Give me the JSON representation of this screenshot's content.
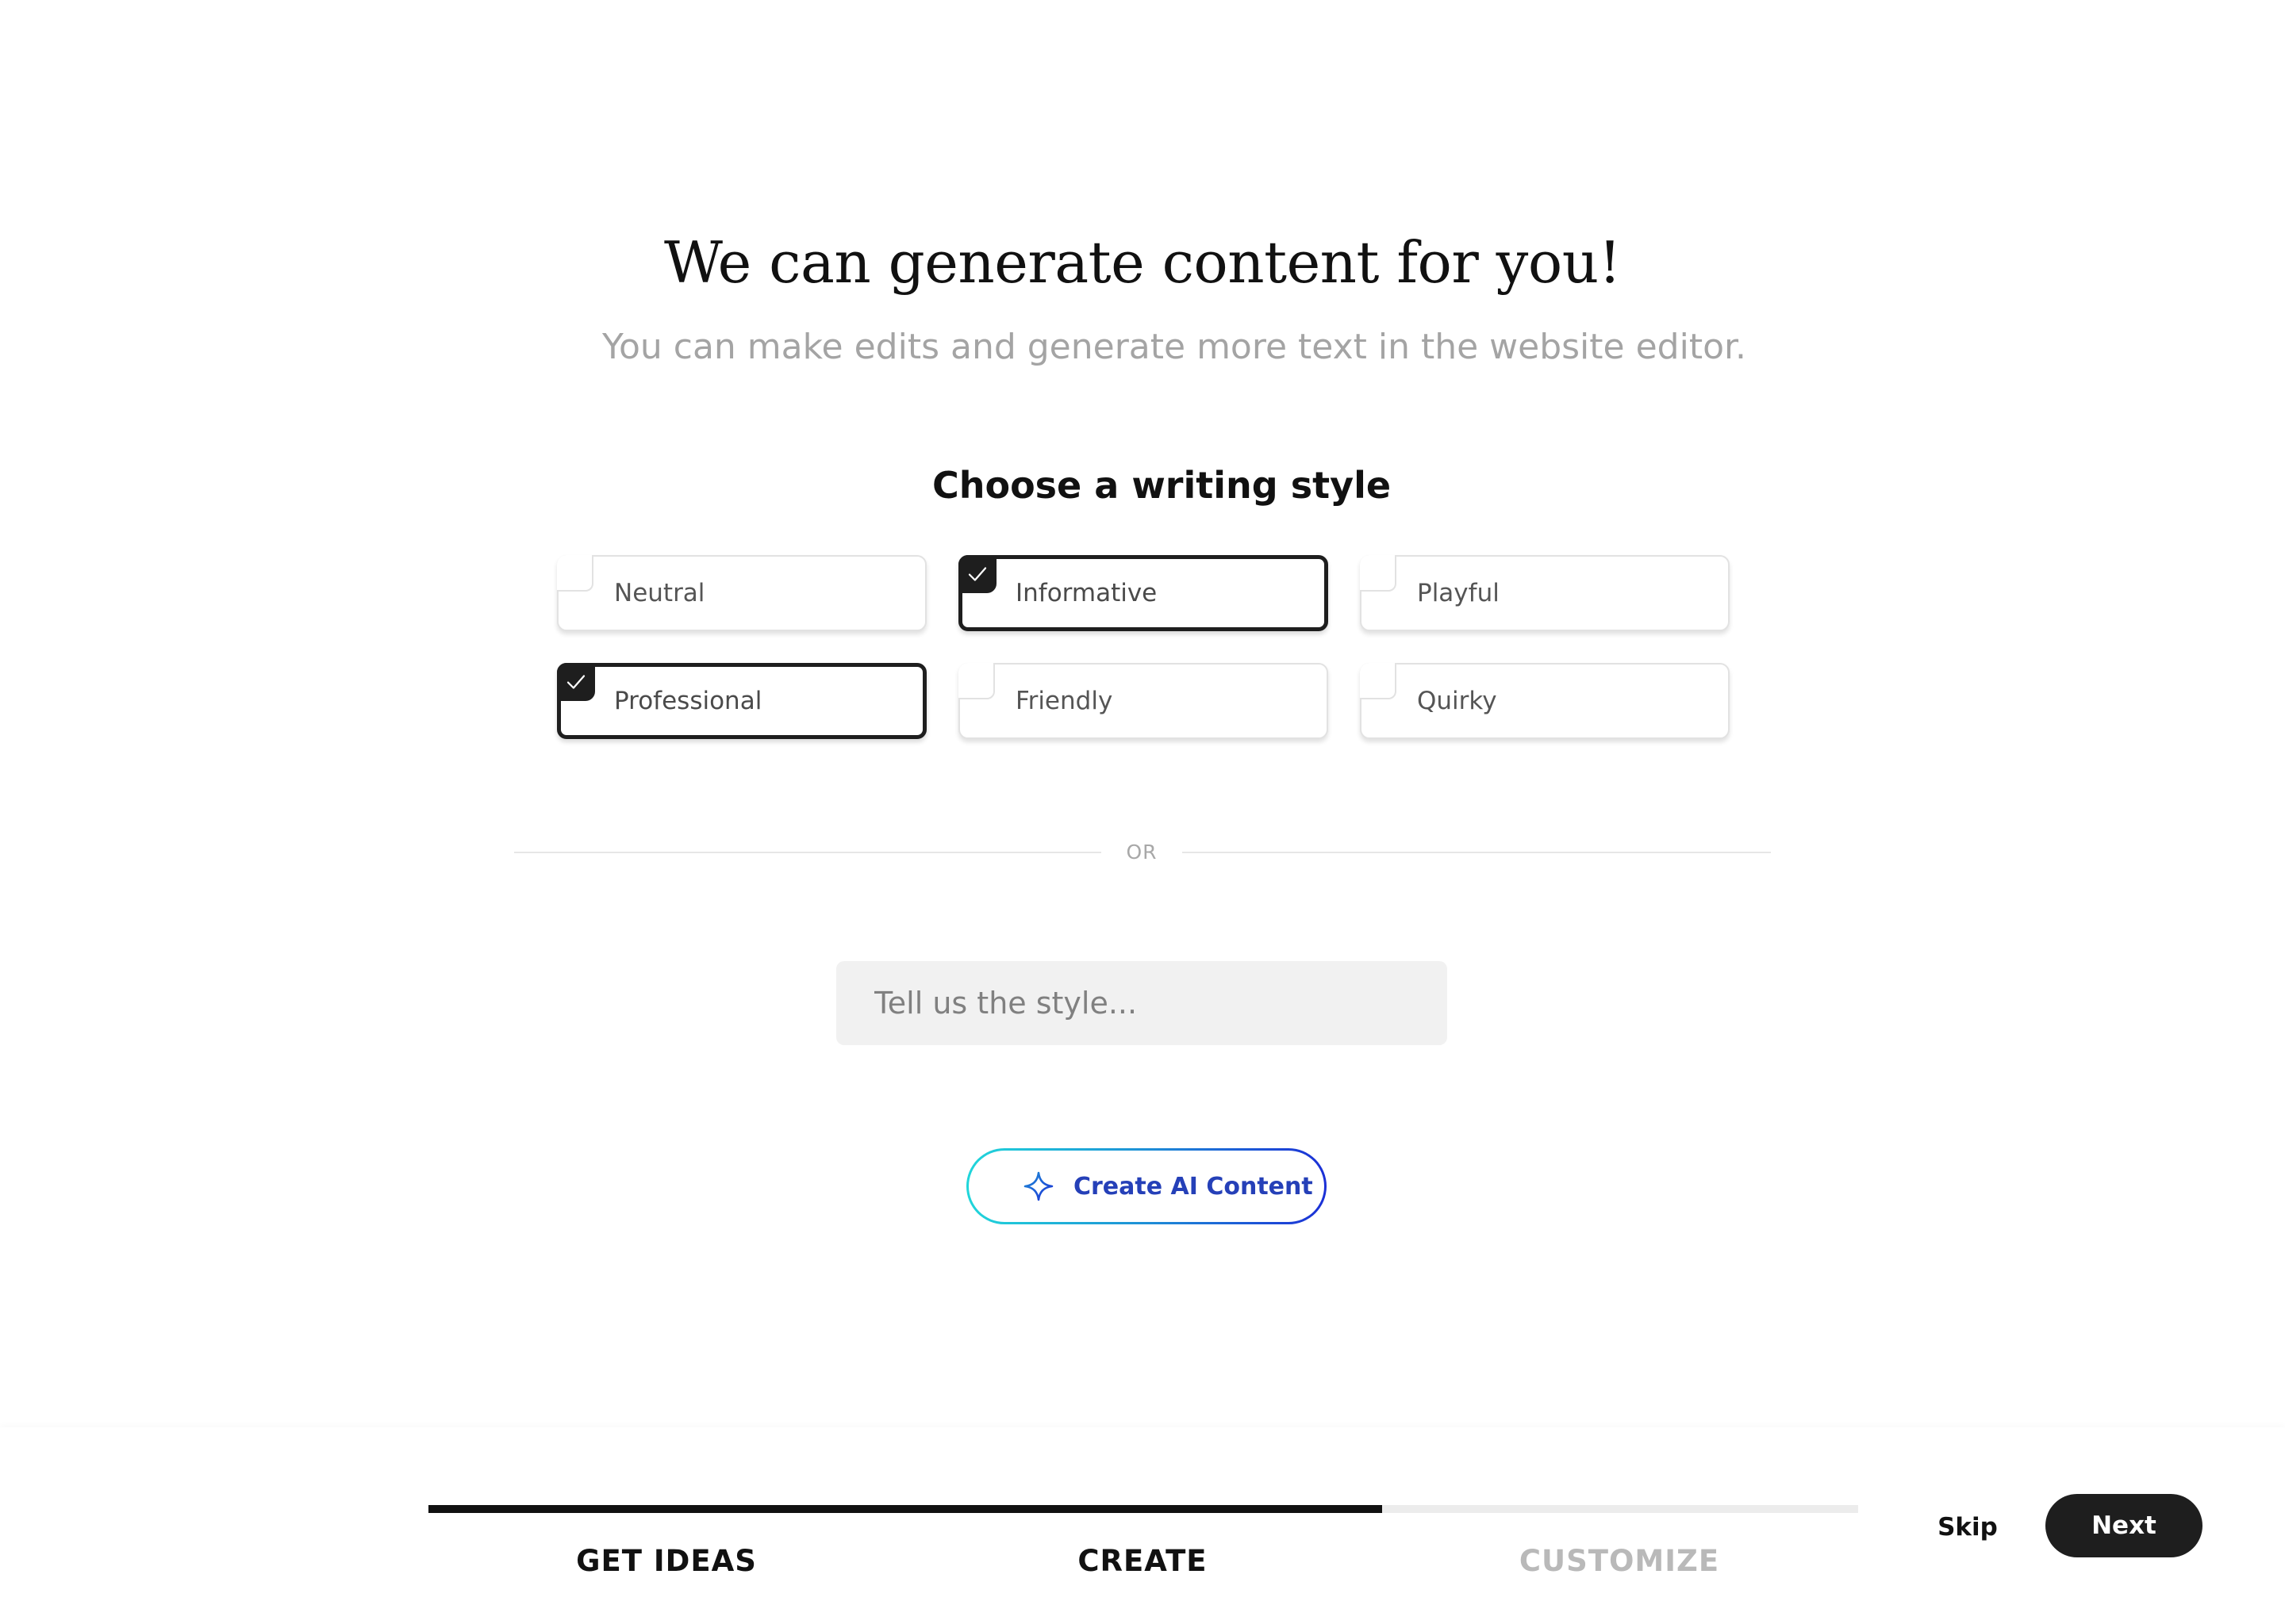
{
  "header": {
    "title": "We can generate content for you!",
    "subtitle": "You can make edits and generate more text in the website editor."
  },
  "style_picker": {
    "title": "Choose a writing style",
    "options": [
      {
        "label": "Neutral",
        "selected": false
      },
      {
        "label": "Informative",
        "selected": true
      },
      {
        "label": "Playful",
        "selected": false
      },
      {
        "label": "Professional",
        "selected": true
      },
      {
        "label": "Friendly",
        "selected": false
      },
      {
        "label": "Quirky",
        "selected": false
      }
    ]
  },
  "divider": {
    "text": "OR"
  },
  "custom_style": {
    "placeholder": "Tell us the style...",
    "value": ""
  },
  "ai_button": {
    "label": "Create AI Content",
    "icon": "sparkle-icon"
  },
  "stepper": {
    "progress_fraction": 0.667,
    "steps": [
      {
        "label": "GET IDEAS",
        "state": "complete"
      },
      {
        "label": "CREATE",
        "state": "current"
      },
      {
        "label": "CUSTOMIZE",
        "state": "upcoming"
      }
    ]
  },
  "footer": {
    "skip_label": "Skip",
    "next_label": "Next"
  },
  "colors": {
    "accent_dark": "#1e1e1e",
    "ai_gradient_start": "#20d6da",
    "ai_gradient_end": "#1b2fd6",
    "ai_text": "#2540b8",
    "muted_text": "#a4a4a4"
  }
}
